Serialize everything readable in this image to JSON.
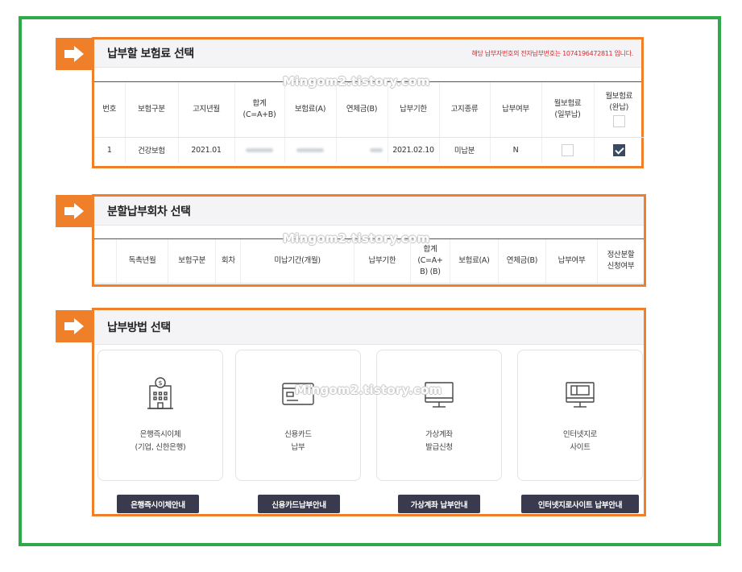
{
  "section1": {
    "title": "납부할 보험료 선택",
    "note": "해당 납부자번호의 전자납부번호는 1074196472811 입니다.",
    "headers": [
      "번호",
      "보험구분",
      "고지년월",
      "합계\n(C=A+B)",
      "보험료(A)",
      "연체금(B)",
      "납부기한",
      "고지종류",
      "납부여부",
      "월보험료\n(일부납)",
      "월보험료\n(완납)"
    ],
    "row": {
      "no": "1",
      "type": "건강보험",
      "month": "2021.01",
      "due": "2021.02.10",
      "kind": "미납분",
      "paid": "N",
      "partial_checked": false,
      "full_checked": true
    }
  },
  "section2": {
    "title": "분할납부회차 선택",
    "headers": [
      "",
      "독촉년월",
      "보험구분",
      "회차",
      "미납기간(개월)",
      "납부기한",
      "합계(C=A+\nB) (B)",
      "보험료(A)",
      "연체금(B)",
      "납부여부",
      "정산분할\n신청여부"
    ]
  },
  "section3": {
    "title": "납부방법 선택",
    "cards": [
      {
        "line1": "은행즉시이체",
        "line2": "(기업, 신한은행)",
        "icon": "bank-building-icon",
        "button": "은행즉시이체안내"
      },
      {
        "line1": "신용카드",
        "line2": "납부",
        "icon": "credit-card-icon",
        "button": "신용카드납부안내"
      },
      {
        "line1": "가상계좌",
        "line2": "발급신청",
        "icon": "monitor-icon",
        "button": "가상계좌 납부안내"
      },
      {
        "line1": "인터넷지로",
        "line2": "사이트",
        "icon": "web-monitor-icon",
        "button": "인터넷지로사이트 납부안내"
      }
    ]
  },
  "watermark": "Mingom2.tistory.com",
  "colors": {
    "frame": "#2eaa4a",
    "accent": "#f07f2a",
    "button": "#3a3a4e",
    "note": "#e0262b",
    "check": "#3a4a66"
  }
}
